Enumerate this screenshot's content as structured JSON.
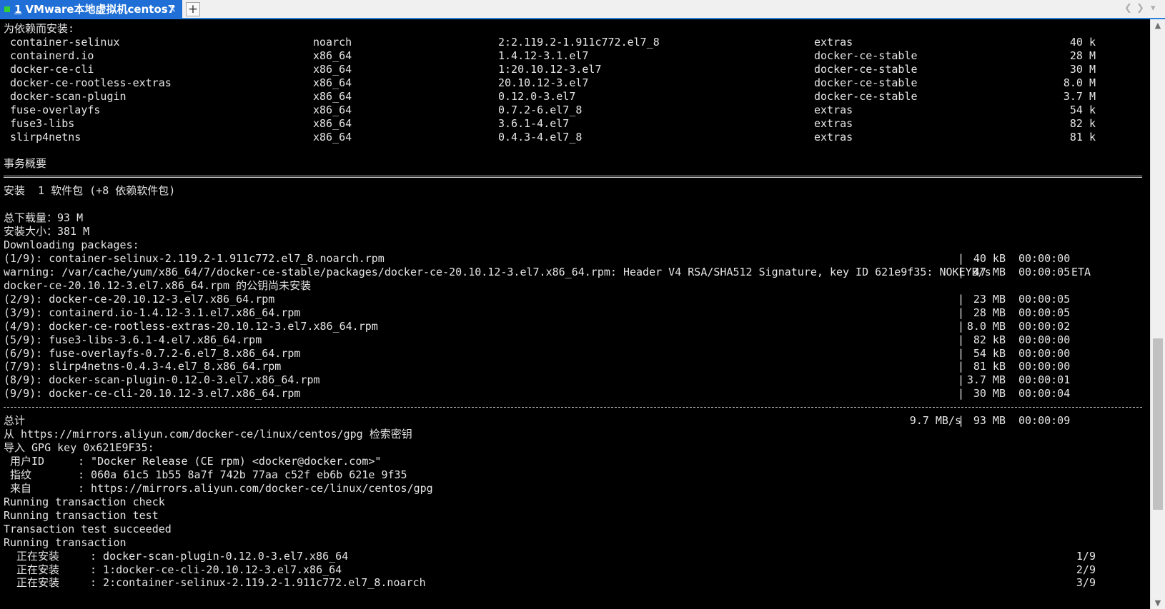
{
  "tab": {
    "number": "1",
    "title": "VMware本地虚拟机centos7",
    "close": "×",
    "new": "+"
  },
  "nav": {
    "prev": "❮",
    "next": "❯",
    "menu": "▾"
  },
  "scrollbar": {
    "up": "▲",
    "down": "▼"
  },
  "deps_header": "为依赖而安装:",
  "packages": [
    {
      "name": "container-selinux",
      "arch": "noarch",
      "version": "2:2.119.2-1.911c772.el7_8",
      "repo": "extras",
      "size": "40 k"
    },
    {
      "name": "containerd.io",
      "arch": "x86_64",
      "version": "1.4.12-3.1.el7",
      "repo": "docker-ce-stable",
      "size": "28 M"
    },
    {
      "name": "docker-ce-cli",
      "arch": "x86_64",
      "version": "1:20.10.12-3.el7",
      "repo": "docker-ce-stable",
      "size": "30 M"
    },
    {
      "name": "docker-ce-rootless-extras",
      "arch": "x86_64",
      "version": "20.10.12-3.el7",
      "repo": "docker-ce-stable",
      "size": "8.0 M"
    },
    {
      "name": "docker-scan-plugin",
      "arch": "x86_64",
      "version": "0.12.0-3.el7",
      "repo": "docker-ce-stable",
      "size": "3.7 M"
    },
    {
      "name": "fuse-overlayfs",
      "arch": "x86_64",
      "version": "0.7.2-6.el7_8",
      "repo": "extras",
      "size": "54 k"
    },
    {
      "name": "fuse3-libs",
      "arch": "x86_64",
      "version": "3.6.1-4.el7",
      "repo": "extras",
      "size": "82 k"
    },
    {
      "name": "slirp4netns",
      "arch": "x86_64",
      "version": "0.4.3-4.el7_8",
      "repo": "extras",
      "size": "81 k"
    }
  ],
  "summary": {
    "header": "事务概要",
    "install_line": "安装  1 软件包 (+8 依赖软件包)",
    "total_download": "总下载量：93 M",
    "install_size": "安装大小：381 M",
    "downloading": "Downloading packages:"
  },
  "downloads": [
    {
      "file": "(1/9): container-selinux-2.119.2-1.911c772.el7_8.noarch.rpm",
      "size": "40 kB",
      "time": "00:00:00",
      "eta": ""
    },
    {
      "file": "warning: /var/cache/yum/x86_64/7/docker-ce-stable/packages/docker-ce-20.10.12-3.el7.x86_64.rpm: Header V4 RSA/SHA512 Signature, key ID 621e9f35: NOKEYB/s",
      "size": "47 MB",
      "time": "00:00:05",
      "eta": "ETA"
    },
    {
      "file": "docker-ce-20.10.12-3.el7.x86_64.rpm 的公钥尚未安装",
      "size": "",
      "time": "",
      "eta": ""
    },
    {
      "file": "(2/9): docker-ce-20.10.12-3.el7.x86_64.rpm",
      "size": "23 MB",
      "time": "00:00:05",
      "eta": ""
    },
    {
      "file": "(3/9): containerd.io-1.4.12-3.1.el7.x86_64.rpm",
      "size": "28 MB",
      "time": "00:00:05",
      "eta": ""
    },
    {
      "file": "(4/9): docker-ce-rootless-extras-20.10.12-3.el7.x86_64.rpm",
      "size": "8.0 MB",
      "time": "00:00:02",
      "eta": ""
    },
    {
      "file": "(5/9): fuse3-libs-3.6.1-4.el7.x86_64.rpm",
      "size": "82 kB",
      "time": "00:00:00",
      "eta": ""
    },
    {
      "file": "(6/9): fuse-overlayfs-0.7.2-6.el7_8.x86_64.rpm",
      "size": "54 kB",
      "time": "00:00:00",
      "eta": ""
    },
    {
      "file": "(7/9): slirp4netns-0.4.3-4.el7_8.x86_64.rpm",
      "size": "81 kB",
      "time": "00:00:00",
      "eta": ""
    },
    {
      "file": "(8/9): docker-scan-plugin-0.12.0-3.el7.x86_64.rpm",
      "size": "3.7 MB",
      "time": "00:00:01",
      "eta": ""
    },
    {
      "file": "(9/9): docker-ce-cli-20.10.12-3.el7.x86_64.rpm",
      "size": "30 MB",
      "time": "00:00:04",
      "eta": ""
    }
  ],
  "total": {
    "label": "总计",
    "speed": "9.7 MB/s",
    "size": "93 MB",
    "time": "00:00:09"
  },
  "gpg": {
    "retrieve": "从 https://mirrors.aliyun.com/docker-ce/linux/centos/gpg 检索密钥",
    "import": "导入 GPG key 0x621E9F35:",
    "userid_label": "用户ID",
    "userid_value": ": \"Docker Release (CE rpm) <docker@docker.com>\"",
    "fingerprint_label": "指纹",
    "fingerprint_value": ": 060a 61c5 1b55 8a7f 742b 77aa c52f eb6b 621e 9f35",
    "from_label": "来自",
    "from_value": ": https://mirrors.aliyun.com/docker-ce/linux/centos/gpg"
  },
  "transaction": [
    "Running transaction check",
    "Running transaction test",
    "Transaction test succeeded",
    "Running transaction"
  ],
  "installing": [
    {
      "label": "正在安装",
      "pkg": ": docker-scan-plugin-0.12.0-3.el7.x86_64",
      "progress": "1/9"
    },
    {
      "label": "正在安装",
      "pkg": ": 1:docker-ce-cli-20.10.12-3.el7.x86_64",
      "progress": "2/9"
    },
    {
      "label": "正在安装",
      "pkg": ": 2:container-selinux-2.119.2-1.911c772.el7_8.noarch",
      "progress": "3/9"
    }
  ]
}
